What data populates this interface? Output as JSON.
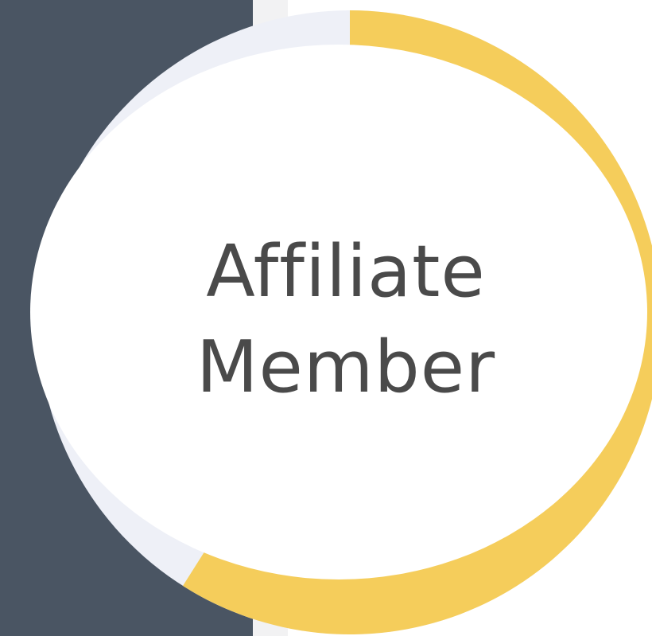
{
  "badge": {
    "line1": "Affiliate",
    "line2": "Member"
  },
  "colors": {
    "left_panel": "#4a5563",
    "strip": "#f2f2f3",
    "ring_progress": "#f5cd5b",
    "ring_track": "#eef0f7",
    "text": "#4a4a4a"
  },
  "ring": {
    "progress_fraction": 0.59
  }
}
